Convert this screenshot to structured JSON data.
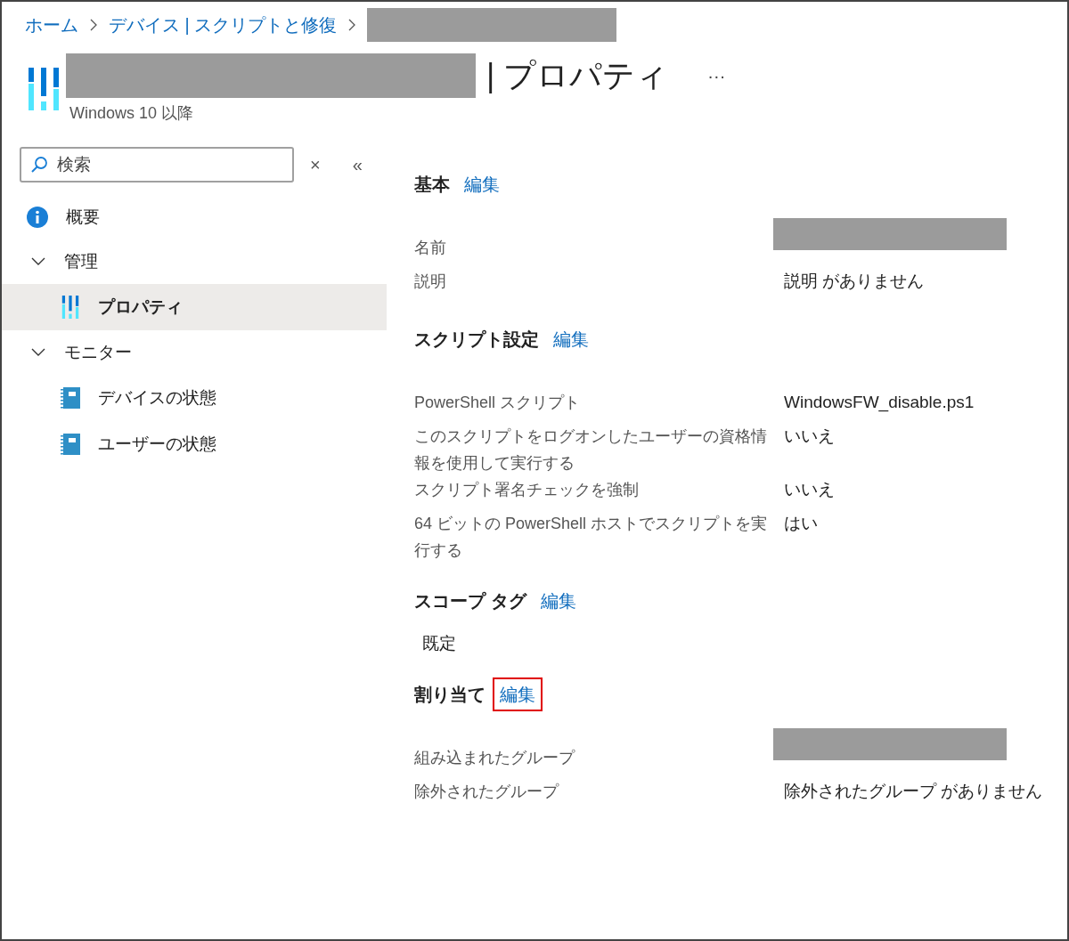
{
  "breadcrumb": [
    {
      "label": "ホーム",
      "kind": "link"
    },
    {
      "label": "デバイス | スクリプトと修復",
      "kind": "link"
    },
    {
      "kind": "redacted"
    }
  ],
  "header": {
    "title_redacted": true,
    "title_suffix": "| プロパティ",
    "more": "···",
    "subtitle": "Windows 10 以降"
  },
  "sidebar": {
    "search": {
      "placeholder": "検索"
    },
    "clear": "×",
    "collapse": "«",
    "items": [
      {
        "label": "概要",
        "kind": "info",
        "selected": false
      },
      {
        "label": "管理",
        "kind": "group",
        "expanded": true,
        "children": [
          {
            "label": "プロパティ",
            "kind": "properties",
            "selected": true
          }
        ]
      },
      {
        "label": "モニター",
        "kind": "group",
        "expanded": true,
        "children": [
          {
            "label": "デバイスの状態",
            "kind": "notebook",
            "selected": false
          },
          {
            "label": "ユーザーの状態",
            "kind": "notebook",
            "selected": false
          }
        ]
      }
    ]
  },
  "sections": [
    {
      "title": "基本",
      "edit": "編集",
      "highlighted": false,
      "kind": "table",
      "rows": [
        {
          "label": "名前",
          "value": null,
          "redacted": true
        },
        {
          "label": "説明",
          "value": "説明 がありません",
          "redacted": false
        }
      ]
    },
    {
      "title": "スクリプト設定",
      "edit": "編集",
      "highlighted": false,
      "kind": "table",
      "rows": [
        {
          "label": "PowerShell スクリプト",
          "value": "WindowsFW_disable.ps1",
          "redacted": false
        },
        {
          "label": "このスクリプトをログオンしたユーザーの資格情報を使用して実行する",
          "value": "いいえ",
          "redacted": false
        },
        {
          "label": "スクリプト署名チェックを強制",
          "value": "いいえ",
          "redacted": false
        },
        {
          "label": "64 ビットの PowerShell ホストでスクリプトを実行する",
          "value": "はい",
          "redacted": false
        }
      ]
    },
    {
      "title": "スコープ タグ",
      "edit": "編集",
      "highlighted": false,
      "kind": "tags",
      "tags": [
        "既定"
      ]
    },
    {
      "title": "割り当て",
      "edit": "編集",
      "highlighted": true,
      "kind": "table",
      "rows": [
        {
          "label": "組み込まれたグループ",
          "value": null,
          "redacted": true
        },
        {
          "label": "除外されたグループ",
          "value": "除外されたグループ がありません",
          "redacted": false
        }
      ]
    }
  ]
}
